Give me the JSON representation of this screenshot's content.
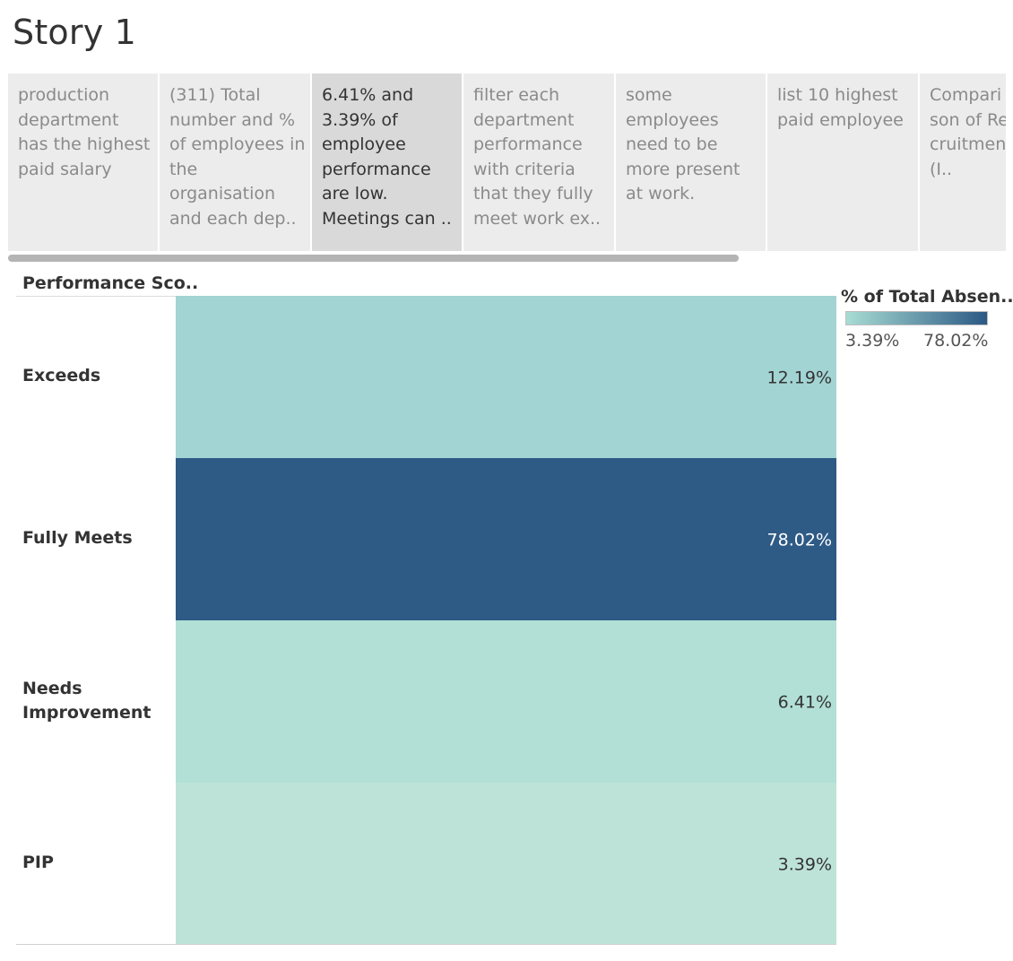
{
  "story": {
    "title": "Story 1"
  },
  "navigator": {
    "points": [
      {
        "text": "production department has the highest paid salary",
        "active": false
      },
      {
        "text": "(311) Total number and % of employees in the organisation and each dep..",
        "active": false
      },
      {
        "text": "6.41% and 3.39% of employee performance are low. Meetings can ..",
        "active": true
      },
      {
        "text": "filter each department performance with criteria that they fully meet work ex..",
        "active": false
      },
      {
        "text": "some employees need to be more present at work.",
        "active": false
      },
      {
        "text": "list 10 highest paid employee",
        "active": false
      },
      {
        "text": "Compari son of Re cruitmen t (I..",
        "active": false
      }
    ]
  },
  "sheet": {
    "column_header": "Performance Sco.."
  },
  "legend": {
    "title": "% of Total Absen..",
    "min_label": "3.39%",
    "max_label": "78.02%",
    "color_low": "#a8dcd3",
    "color_high": "#2b5985"
  },
  "chart_data": {
    "type": "bar",
    "categories": [
      "Exceeds",
      "Fully Meets",
      "Needs Improvement",
      "PIP"
    ],
    "values": [
      12.19,
      78.02,
      6.41,
      3.39
    ],
    "value_labels": [
      "12.19%",
      "78.02%",
      "6.41%",
      "3.39%"
    ],
    "colors": [
      "#a2d4d3",
      "#2e5a86",
      "#b2e0d6",
      "#bde3d9"
    ],
    "color_encoding": "% of Total Absen..",
    "grid": false
  }
}
